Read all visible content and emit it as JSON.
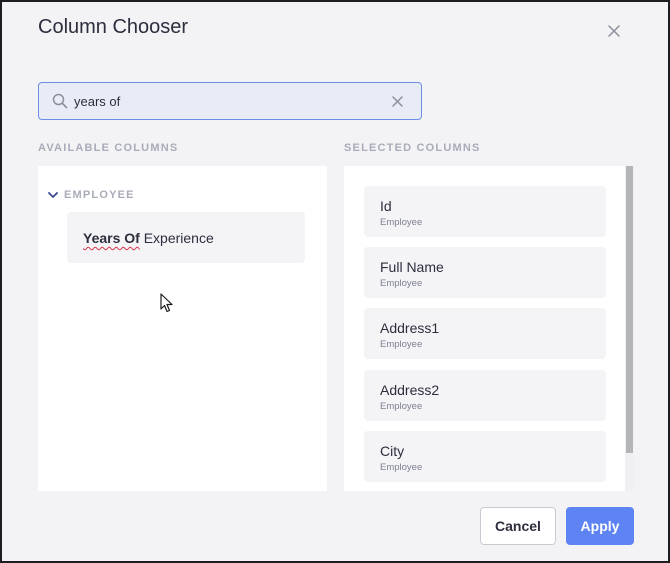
{
  "dialog": {
    "title": "Column Chooser"
  },
  "search": {
    "value": "years of",
    "placeholder": ""
  },
  "available": {
    "heading": "AVAILABLE COLUMNS",
    "group_label": "EMPLOYEE",
    "item": {
      "highlight": "Years Of",
      "rest": " Experience"
    }
  },
  "selected": {
    "heading": "SELECTED COLUMNS",
    "items": [
      {
        "name": "Id",
        "group": "Employee"
      },
      {
        "name": "Full Name",
        "group": "Employee"
      },
      {
        "name": "Address1",
        "group": "Employee"
      },
      {
        "name": "Address2",
        "group": "Employee"
      },
      {
        "name": "City",
        "group": "Employee"
      }
    ]
  },
  "buttons": {
    "cancel": "Cancel",
    "apply": "Apply"
  },
  "colors": {
    "accent": "#5e83f2",
    "search_border": "#6d8de8",
    "highlight_underline": "#d9334a"
  },
  "icons": [
    "close-icon",
    "search-icon",
    "clear-icon",
    "chevron-down-icon",
    "mouse-cursor-icon"
  ]
}
